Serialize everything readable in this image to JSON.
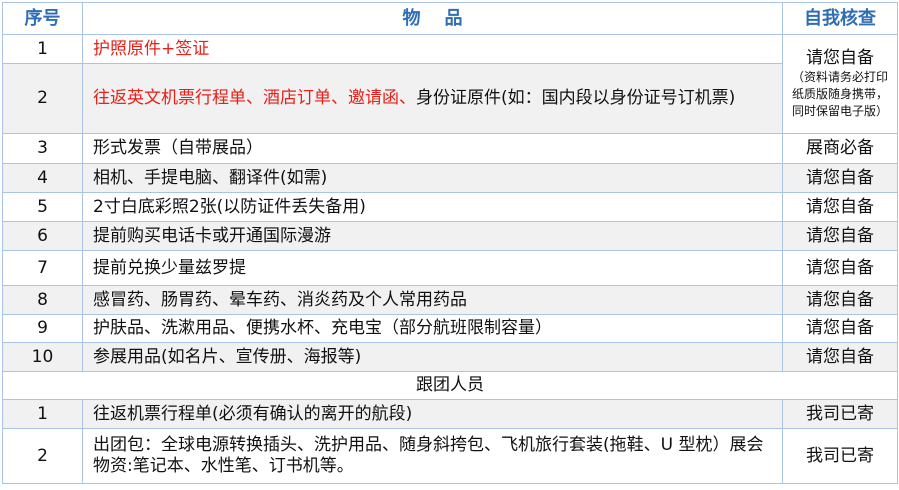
{
  "header": {
    "col_no": "序号",
    "col_item_chars": [
      "物",
      "品"
    ],
    "col_check": "自我核查"
  },
  "rows": [
    {
      "no": "1",
      "item_red": "护照原件+签证",
      "item_black": "",
      "check": "请您自备"
    },
    {
      "no": "2",
      "item_red": "往返英文机票行程单、酒店订单、邀请函、",
      "item_black": "身份证原件(如：国内段以身份证号订机票)",
      "check_note": "（资料请务必打印纸质版随身携带，同时保留电子版）"
    },
    {
      "no": "3",
      "item": "形式发票（自带展品）",
      "check": "展商必备"
    },
    {
      "no": "4",
      "item": "相机、手提电脑、翻译件(如需)",
      "check": "请您自备"
    },
    {
      "no": "5",
      "item": "2寸白底彩照2张(以防证件丢失备用)",
      "check": "请您自备"
    },
    {
      "no": "6",
      "item": "提前购买电话卡或开通国际漫游",
      "check": "请您自备"
    },
    {
      "no": "7",
      "item": "提前兑换少量兹罗提",
      "check": "请您自备"
    },
    {
      "no": "8",
      "item": "感冒药、肠胃药、晕车药、消炎药及个人常用药品",
      "check": "请您自备"
    },
    {
      "no": "9",
      "item": "护肤品、洗漱用品、便携水杯、充电宝（部分航班限制容量）",
      "check": "请您自备"
    },
    {
      "no": "10",
      "item": "参展用品(如名片、宣传册、海报等)",
      "check": "请您自备"
    }
  ],
  "section_title": "跟团人员",
  "staff_rows": [
    {
      "no": "1",
      "item": "往返机票行程单(必须有确认的离开的航段)",
      "check": "我司已寄"
    },
    {
      "no": "2",
      "item": "出团包：全球电源转换插头、洗护用品、随身斜挎包、飞机旅行套装(拖鞋、U 型枕）展会物资:笔记本、水性笔、订书机等。",
      "check": "我司已寄"
    }
  ]
}
